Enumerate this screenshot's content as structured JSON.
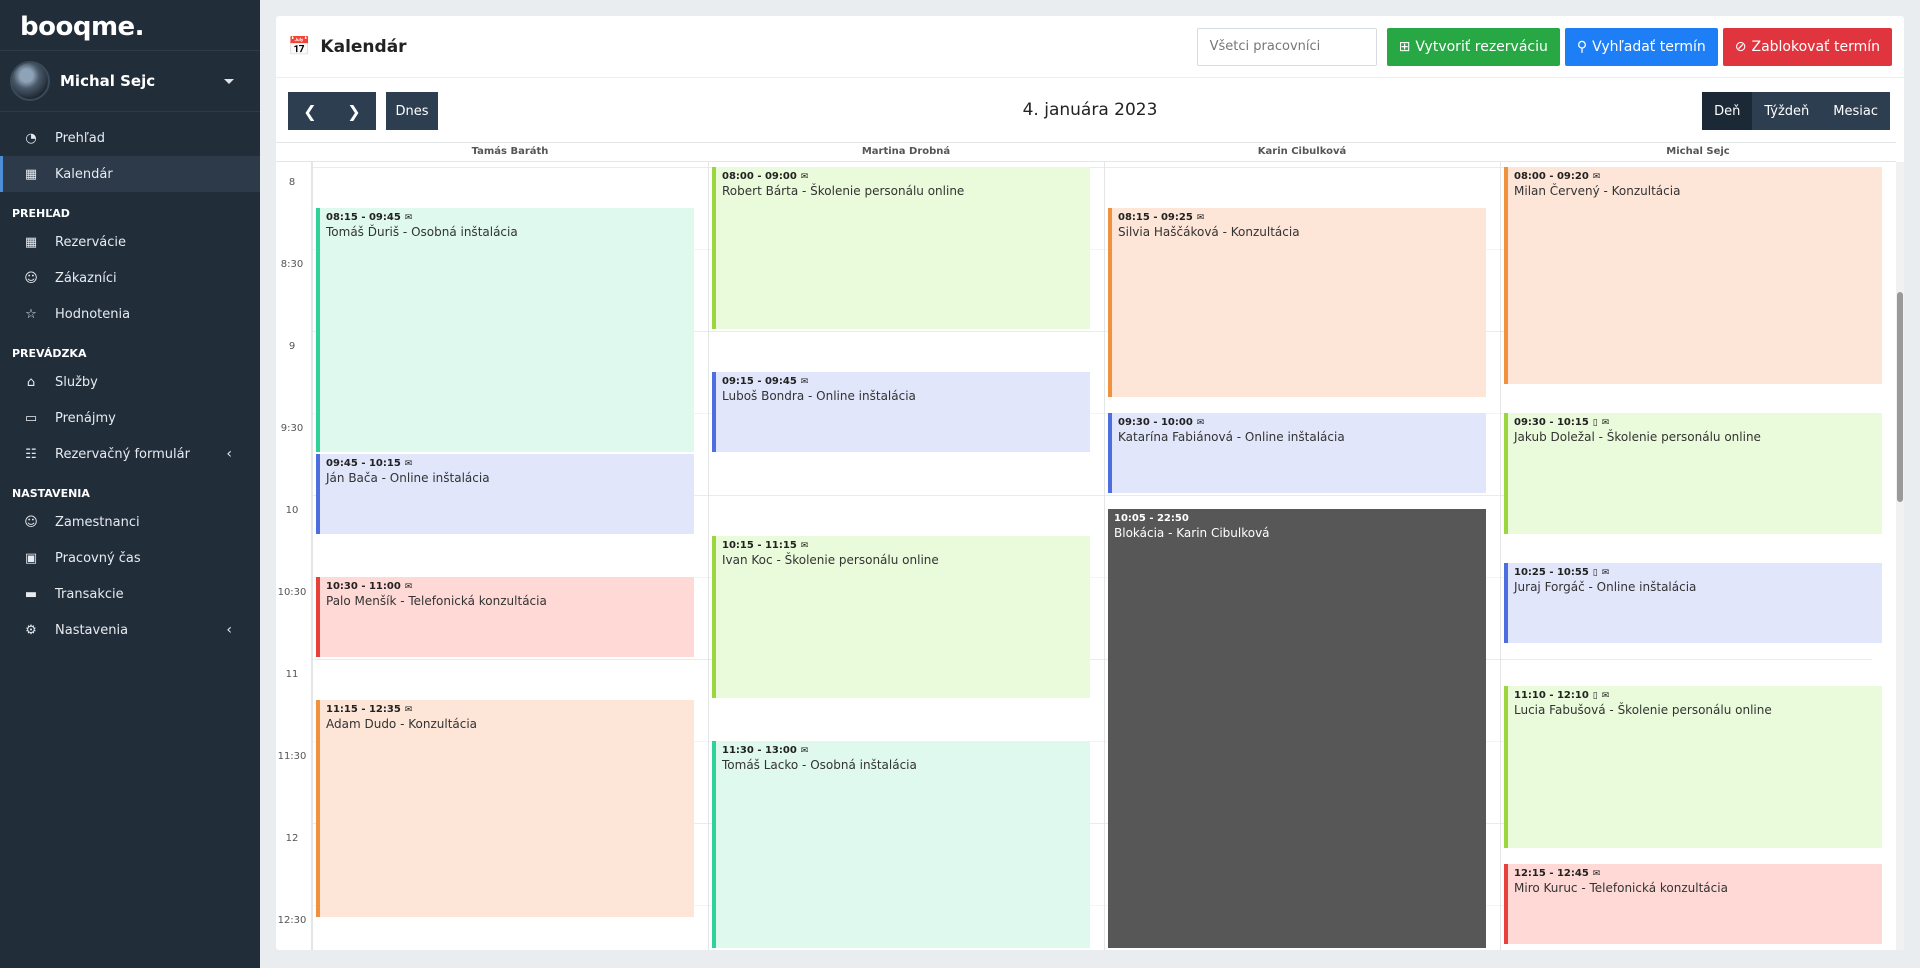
{
  "app": {
    "logo": "booqme."
  },
  "sidebar": {
    "user": {
      "name": "Michal Sejc"
    },
    "main_items": [
      {
        "label": "Prehľad",
        "icon": "gauge-icon"
      },
      {
        "label": "Kalendár",
        "icon": "calendar-icon",
        "active": true
      }
    ],
    "sections": [
      {
        "title": "PREHĽAD",
        "items": [
          {
            "label": "Rezervácie",
            "icon": "calendar-icon"
          },
          {
            "label": "Zákazníci",
            "icon": "users-icon"
          },
          {
            "label": "Hodnotenia",
            "icon": "star-icon"
          }
        ]
      },
      {
        "title": "PREVÁDZKA",
        "items": [
          {
            "label": "Služby",
            "icon": "bell-icon"
          },
          {
            "label": "Prenájmy",
            "icon": "van-icon"
          },
          {
            "label": "Rezervačný formulár",
            "icon": "clipboard-icon",
            "expandable": true
          }
        ]
      },
      {
        "title": "NASTAVENIA",
        "items": [
          {
            "label": "Zamestnanci",
            "icon": "users-icon"
          },
          {
            "label": "Pracovný čas",
            "icon": "briefcase-icon"
          },
          {
            "label": "Transakcie",
            "icon": "credit-card-icon"
          },
          {
            "label": "Nastavenia",
            "icon": "gear-icon",
            "expandable": true
          }
        ]
      }
    ]
  },
  "header": {
    "title": "Kalendár",
    "employee_select": "Všetci pracovníci",
    "create_label": "Vytvoriť rezerváciu",
    "search_label": "Vyhľadať termín",
    "block_label": "Zablokovať termín"
  },
  "toolbar": {
    "today_label": "Dnes",
    "date": "4. januára 2023",
    "views": [
      {
        "label": "Deň",
        "active": true
      },
      {
        "label": "Týždeň",
        "active": false
      },
      {
        "label": "Mesiac",
        "active": false
      }
    ]
  },
  "calendar": {
    "time_labels": [
      {
        "label": "8",
        "hour": 8
      },
      {
        "label": "8:30",
        "hour": 8.5
      },
      {
        "label": "9",
        "hour": 9
      },
      {
        "label": "9:30",
        "hour": 9.5
      },
      {
        "label": "10",
        "hour": 10
      },
      {
        "label": "10:30",
        "hour": 10.5
      },
      {
        "label": "11",
        "hour": 11
      },
      {
        "label": "11:30",
        "hour": 11.5
      },
      {
        "label": "12",
        "hour": 12
      },
      {
        "label": "12:30",
        "hour": 12.5
      }
    ],
    "columns": [
      {
        "name": "Tamás Baráth",
        "events": [
          {
            "time": "08:15 - 09:45",
            "title": "Tomáš Ďuriš - Osobná inštalácia",
            "start": 8.25,
            "end": 9.75,
            "color": "#2fd39a",
            "bg": "#dff9ef",
            "icons": [
              "email-icon"
            ]
          },
          {
            "time": "09:45 - 10:15",
            "title": "Ján Bača - Online inštalácia",
            "start": 9.75,
            "end": 10.25,
            "color": "#4c6ee0",
            "bg": "#e1e6fb",
            "icons": [
              "email-icon"
            ]
          },
          {
            "time": "10:30 - 11:00",
            "title": "Palo Menšík - Telefonická konzultácia",
            "start": 10.5,
            "end": 11.0,
            "color": "#e8403a",
            "bg": "#ffd9d6",
            "icons": [
              "email-icon"
            ]
          },
          {
            "time": "11:15 - 12:35",
            "title": "Adam Dudo - Konzultácia",
            "start": 11.25,
            "end": 12.583,
            "color": "#f0913e",
            "bg": "#fde6d8",
            "icons": [
              "email-icon"
            ]
          }
        ]
      },
      {
        "name": "Martina Drobná",
        "events": [
          {
            "time": "08:00 - 09:00",
            "title": "Robert Bárta - Školenie personálu online",
            "start": 8.0,
            "end": 9.0,
            "color": "#9cd63f",
            "bg": "#eafbdb",
            "icons": [
              "email-icon"
            ]
          },
          {
            "time": "09:15 - 09:45",
            "title": "Luboš Bondra - Online inštalácia",
            "start": 9.25,
            "end": 9.75,
            "color": "#4c6ee0",
            "bg": "#e1e6fb",
            "icons": [
              "email-icon"
            ]
          },
          {
            "time": "10:15 - 11:15",
            "title": "Ivan Koc - Školenie personálu online",
            "start": 10.25,
            "end": 11.25,
            "color": "#9cd63f",
            "bg": "#eafbdb",
            "icons": [
              "email-icon"
            ]
          },
          {
            "time": "11:30 - 13:00",
            "title": "Tomáš Lacko - Osobná inštalácia",
            "start": 11.5,
            "end": 13.0,
            "color": "#2fd39a",
            "bg": "#dff9ef",
            "icons": [
              "email-icon"
            ]
          }
        ]
      },
      {
        "name": "Karin Cibulková",
        "events": [
          {
            "time": "08:15 - 09:25",
            "title": "Silvia Haščáková - Konzultácia",
            "start": 8.25,
            "end": 9.417,
            "color": "#f0913e",
            "bg": "#fde6d8",
            "icons": [
              "email-icon"
            ]
          },
          {
            "time": "09:30 - 10:00",
            "title": "Katarína Fabiánová - Online inštalácia",
            "start": 9.5,
            "end": 10.0,
            "color": "#4c6ee0",
            "bg": "#e1e6fb",
            "icons": [
              "email-icon"
            ]
          },
          {
            "time": "10:05 - 22:50",
            "title": "Blokácia - Karin Cibulková",
            "start": 10.083,
            "end": 22.833,
            "block": true,
            "icons": []
          }
        ]
      },
      {
        "name": "Michal Sejc",
        "events": [
          {
            "time": "08:00 - 09:20",
            "title": "Milan Červený - Konzultácia",
            "start": 8.0,
            "end": 9.333,
            "color": "#f0913e",
            "bg": "#fde6d8",
            "icons": [
              "email-icon"
            ]
          },
          {
            "time": "09:30 - 10:15",
            "title": "Jakub Doležal - Školenie personálu online",
            "start": 9.5,
            "end": 10.25,
            "color": "#9cd63f",
            "bg": "#eafbdb",
            "icons": [
              "phone-icon",
              "email-icon"
            ]
          },
          {
            "time": "10:25 - 10:55",
            "title": "Juraj Forgáč - Online inštalácia",
            "start": 10.417,
            "end": 10.917,
            "color": "#4c6ee0",
            "bg": "#e1e6fb",
            "icons": [
              "phone-icon",
              "email-icon"
            ]
          },
          {
            "time": "11:10 - 12:10",
            "title": "Lucia Fabušová - Školenie personálu online",
            "start": 11.167,
            "end": 12.167,
            "color": "#9cd63f",
            "bg": "#eafbdb",
            "icons": [
              "phone-icon",
              "email-icon"
            ]
          },
          {
            "time": "12:15 - 12:45",
            "title": "Miro Kuruc - Telefonická konzultácia",
            "start": 12.25,
            "end": 12.75,
            "color": "#e8403a",
            "bg": "#ffd9d6",
            "icons": [
              "email-icon"
            ]
          }
        ]
      }
    ]
  }
}
